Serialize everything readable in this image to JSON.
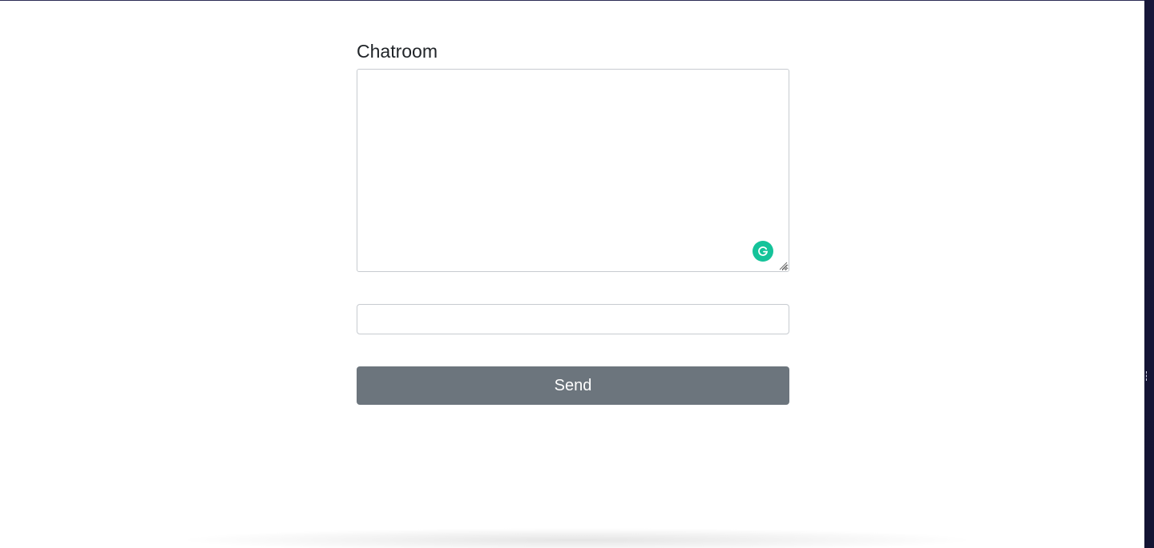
{
  "chatroom": {
    "title": "Chatroom",
    "log_value": "",
    "message_value": "",
    "message_placeholder": "",
    "send_label": "Send"
  },
  "icons": {
    "grammarly": "grammarly-g-icon",
    "resize": "resize-grip-icon"
  },
  "colors": {
    "send_button_bg": "#6c757d",
    "grammarly_green": "#15c39a",
    "side_strip": "#17173a"
  }
}
